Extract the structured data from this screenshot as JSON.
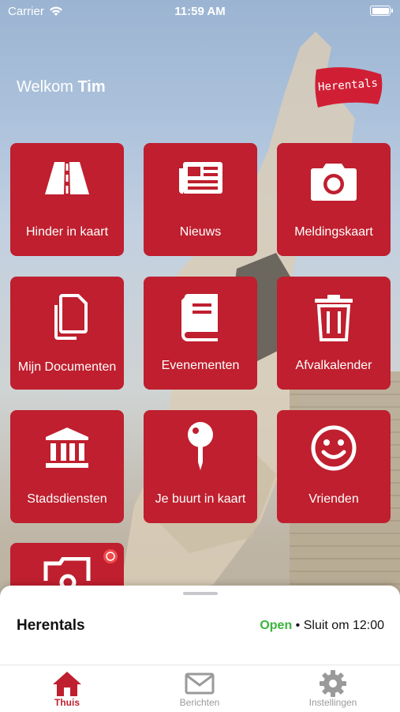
{
  "status_bar": {
    "carrier": "Carrier",
    "time": "11:59 AM"
  },
  "header": {
    "welcome": "Welkom",
    "user": "Tim",
    "logo_text": "Herentals"
  },
  "tiles": [
    {
      "label": "Hinder in kaart",
      "icon": "road-icon"
    },
    {
      "label": "Nieuws",
      "icon": "newspaper-icon"
    },
    {
      "label": "Meldingskaart",
      "icon": "camera-icon"
    },
    {
      "label": "Mijn Documenten",
      "icon": "documents-icon"
    },
    {
      "label": "Evenementen",
      "icon": "book-icon"
    },
    {
      "label": "Afvalkalender",
      "icon": "trash-icon"
    },
    {
      "label": "Stadsdiensten",
      "icon": "building-icon"
    },
    {
      "label": "Je buurt in kaart",
      "icon": "map-pin-icon"
    },
    {
      "label": "Vrienden",
      "icon": "smiley-icon"
    },
    {
      "label": "",
      "icon": "photo-icon"
    }
  ],
  "sheet": {
    "title": "Herentals",
    "status": "Open",
    "closes": "• Sluit om 12:00"
  },
  "tabbar": [
    {
      "label": "Thuis",
      "icon": "home-icon",
      "active": true
    },
    {
      "label": "Berichten",
      "icon": "mail-icon",
      "active": false
    },
    {
      "label": "Instellingen",
      "icon": "gear-icon",
      "active": false
    }
  ],
  "colors": {
    "brand_red": "#bf1f2e",
    "open_green": "#3bb43b"
  }
}
